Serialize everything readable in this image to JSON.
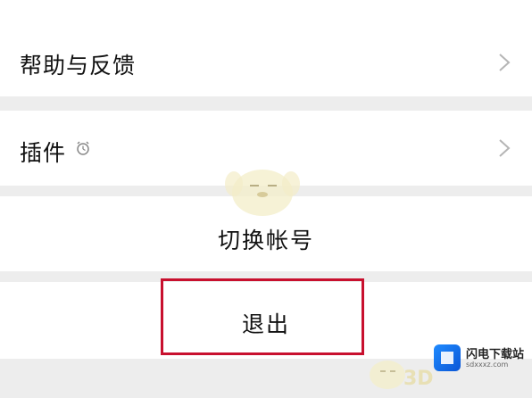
{
  "menu": {
    "help_label": "帮助与反馈",
    "plugins_label": "插件",
    "switch_account_label": "切换帐号",
    "logout_label": "退出"
  },
  "icons": {
    "chevron": "chevron-right-icon",
    "plugin_badge": "alarm-clock-icon"
  },
  "watermark": {
    "brand_name": "闪电下载站",
    "brand_url": "sdxxxz.com",
    "mark_3d": "3D"
  },
  "colors": {
    "page_bg": "#ededed",
    "row_bg": "#ffffff",
    "highlight": "#c8102e",
    "chevron": "#b5b5b5"
  }
}
